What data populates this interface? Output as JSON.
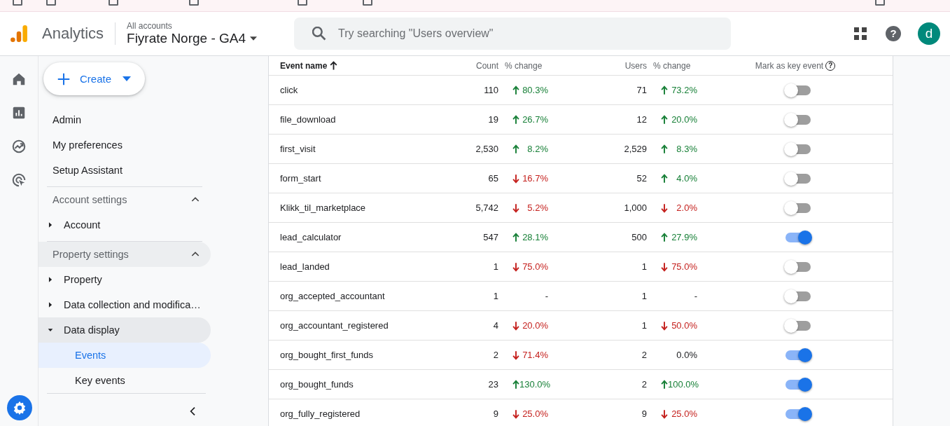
{
  "header": {
    "product": "Analytics",
    "account_path": "All accounts",
    "property": "Fiyrate Norge - GA4",
    "search": {
      "placeholder": "Try searching \"Users overview\""
    },
    "help": "?",
    "avatar": "d"
  },
  "nav": {
    "create": "Create",
    "links": [
      {
        "label": "Admin"
      },
      {
        "label": "My preferences"
      },
      {
        "label": "Setup Assistant"
      }
    ],
    "sections": [
      {
        "title": "Account settings",
        "expanded": true,
        "active": false,
        "children": [
          {
            "label": "Account",
            "expanded": false,
            "active": false
          }
        ]
      },
      {
        "title": "Property settings",
        "expanded": true,
        "active": true,
        "children": [
          {
            "label": "Property",
            "expanded": false,
            "active": false
          },
          {
            "label": "Data collection and modifica…",
            "expanded": false,
            "active": false
          },
          {
            "label": "Data display",
            "expanded": true,
            "active": true,
            "children": [
              {
                "label": "Events",
                "selected": true
              },
              {
                "label": "Key events",
                "selected": false
              }
            ]
          }
        ]
      }
    ]
  },
  "table": {
    "columns": [
      {
        "label": "Event name",
        "sorted_ascending": true
      },
      {
        "label": "Count"
      },
      {
        "label": "% change"
      },
      {
        "label": "Users"
      },
      {
        "label": "% change"
      },
      {
        "label": "Mark as key event",
        "help": "?"
      }
    ],
    "rows": [
      {
        "name": "click",
        "count": "110",
        "count_change": {
          "kind": "increase",
          "value": "80.3%"
        },
        "users": "71",
        "users_change": {
          "kind": "increase",
          "value": "73.2%"
        },
        "key_event": false
      },
      {
        "name": "file_download",
        "count": "19",
        "count_change": {
          "kind": "increase",
          "value": "26.7%"
        },
        "users": "12",
        "users_change": {
          "kind": "increase",
          "value": "20.0%"
        },
        "key_event": false
      },
      {
        "name": "first_visit",
        "count": "2,530",
        "count_change": {
          "kind": "increase",
          "value": "8.2%"
        },
        "users": "2,529",
        "users_change": {
          "kind": "increase",
          "value": "8.3%"
        },
        "key_event": false
      },
      {
        "name": "form_start",
        "count": "65",
        "count_change": {
          "kind": "decrease",
          "value": "16.7%"
        },
        "users": "52",
        "users_change": {
          "kind": "increase",
          "value": "4.0%"
        },
        "key_event": false
      },
      {
        "name": "Klikk_til_marketplace",
        "count": "5,742",
        "count_change": {
          "kind": "decrease",
          "value": "5.2%"
        },
        "users": "1,000",
        "users_change": {
          "kind": "decrease",
          "value": "2.0%"
        },
        "key_event": false
      },
      {
        "name": "lead_calculator",
        "count": "547",
        "count_change": {
          "kind": "increase",
          "value": "28.1%"
        },
        "users": "500",
        "users_change": {
          "kind": "increase",
          "value": "27.9%"
        },
        "key_event": true
      },
      {
        "name": "lead_landed",
        "count": "1",
        "count_change": {
          "kind": "decrease",
          "value": "75.0%"
        },
        "users": "1",
        "users_change": {
          "kind": "decrease",
          "value": "75.0%"
        },
        "key_event": false
      },
      {
        "name": "org_accepted_accountant",
        "count": "1",
        "count_change": {
          "kind": "flat",
          "value": "-"
        },
        "users": "1",
        "users_change": {
          "kind": "flat",
          "value": "-"
        },
        "key_event": false
      },
      {
        "name": "org_accountant_registered",
        "count": "4",
        "count_change": {
          "kind": "decrease",
          "value": "20.0%"
        },
        "users": "1",
        "users_change": {
          "kind": "decrease",
          "value": "50.0%"
        },
        "key_event": false
      },
      {
        "name": "org_bought_first_funds",
        "count": "2",
        "count_change": {
          "kind": "decrease",
          "value": "71.4%"
        },
        "users": "2",
        "users_change": {
          "kind": "flat",
          "value": "0.0%"
        },
        "key_event": true
      },
      {
        "name": "org_bought_funds",
        "count": "23",
        "count_change": {
          "kind": "increase",
          "value": "130.0%"
        },
        "users": "2",
        "users_change": {
          "kind": "increase",
          "value": "100.0%"
        },
        "key_event": true
      },
      {
        "name": "org_fully_registered",
        "count": "9",
        "count_change": {
          "kind": "decrease",
          "value": "25.0%"
        },
        "users": "9",
        "users_change": {
          "kind": "decrease",
          "value": "25.0%"
        },
        "key_event": true
      }
    ]
  }
}
